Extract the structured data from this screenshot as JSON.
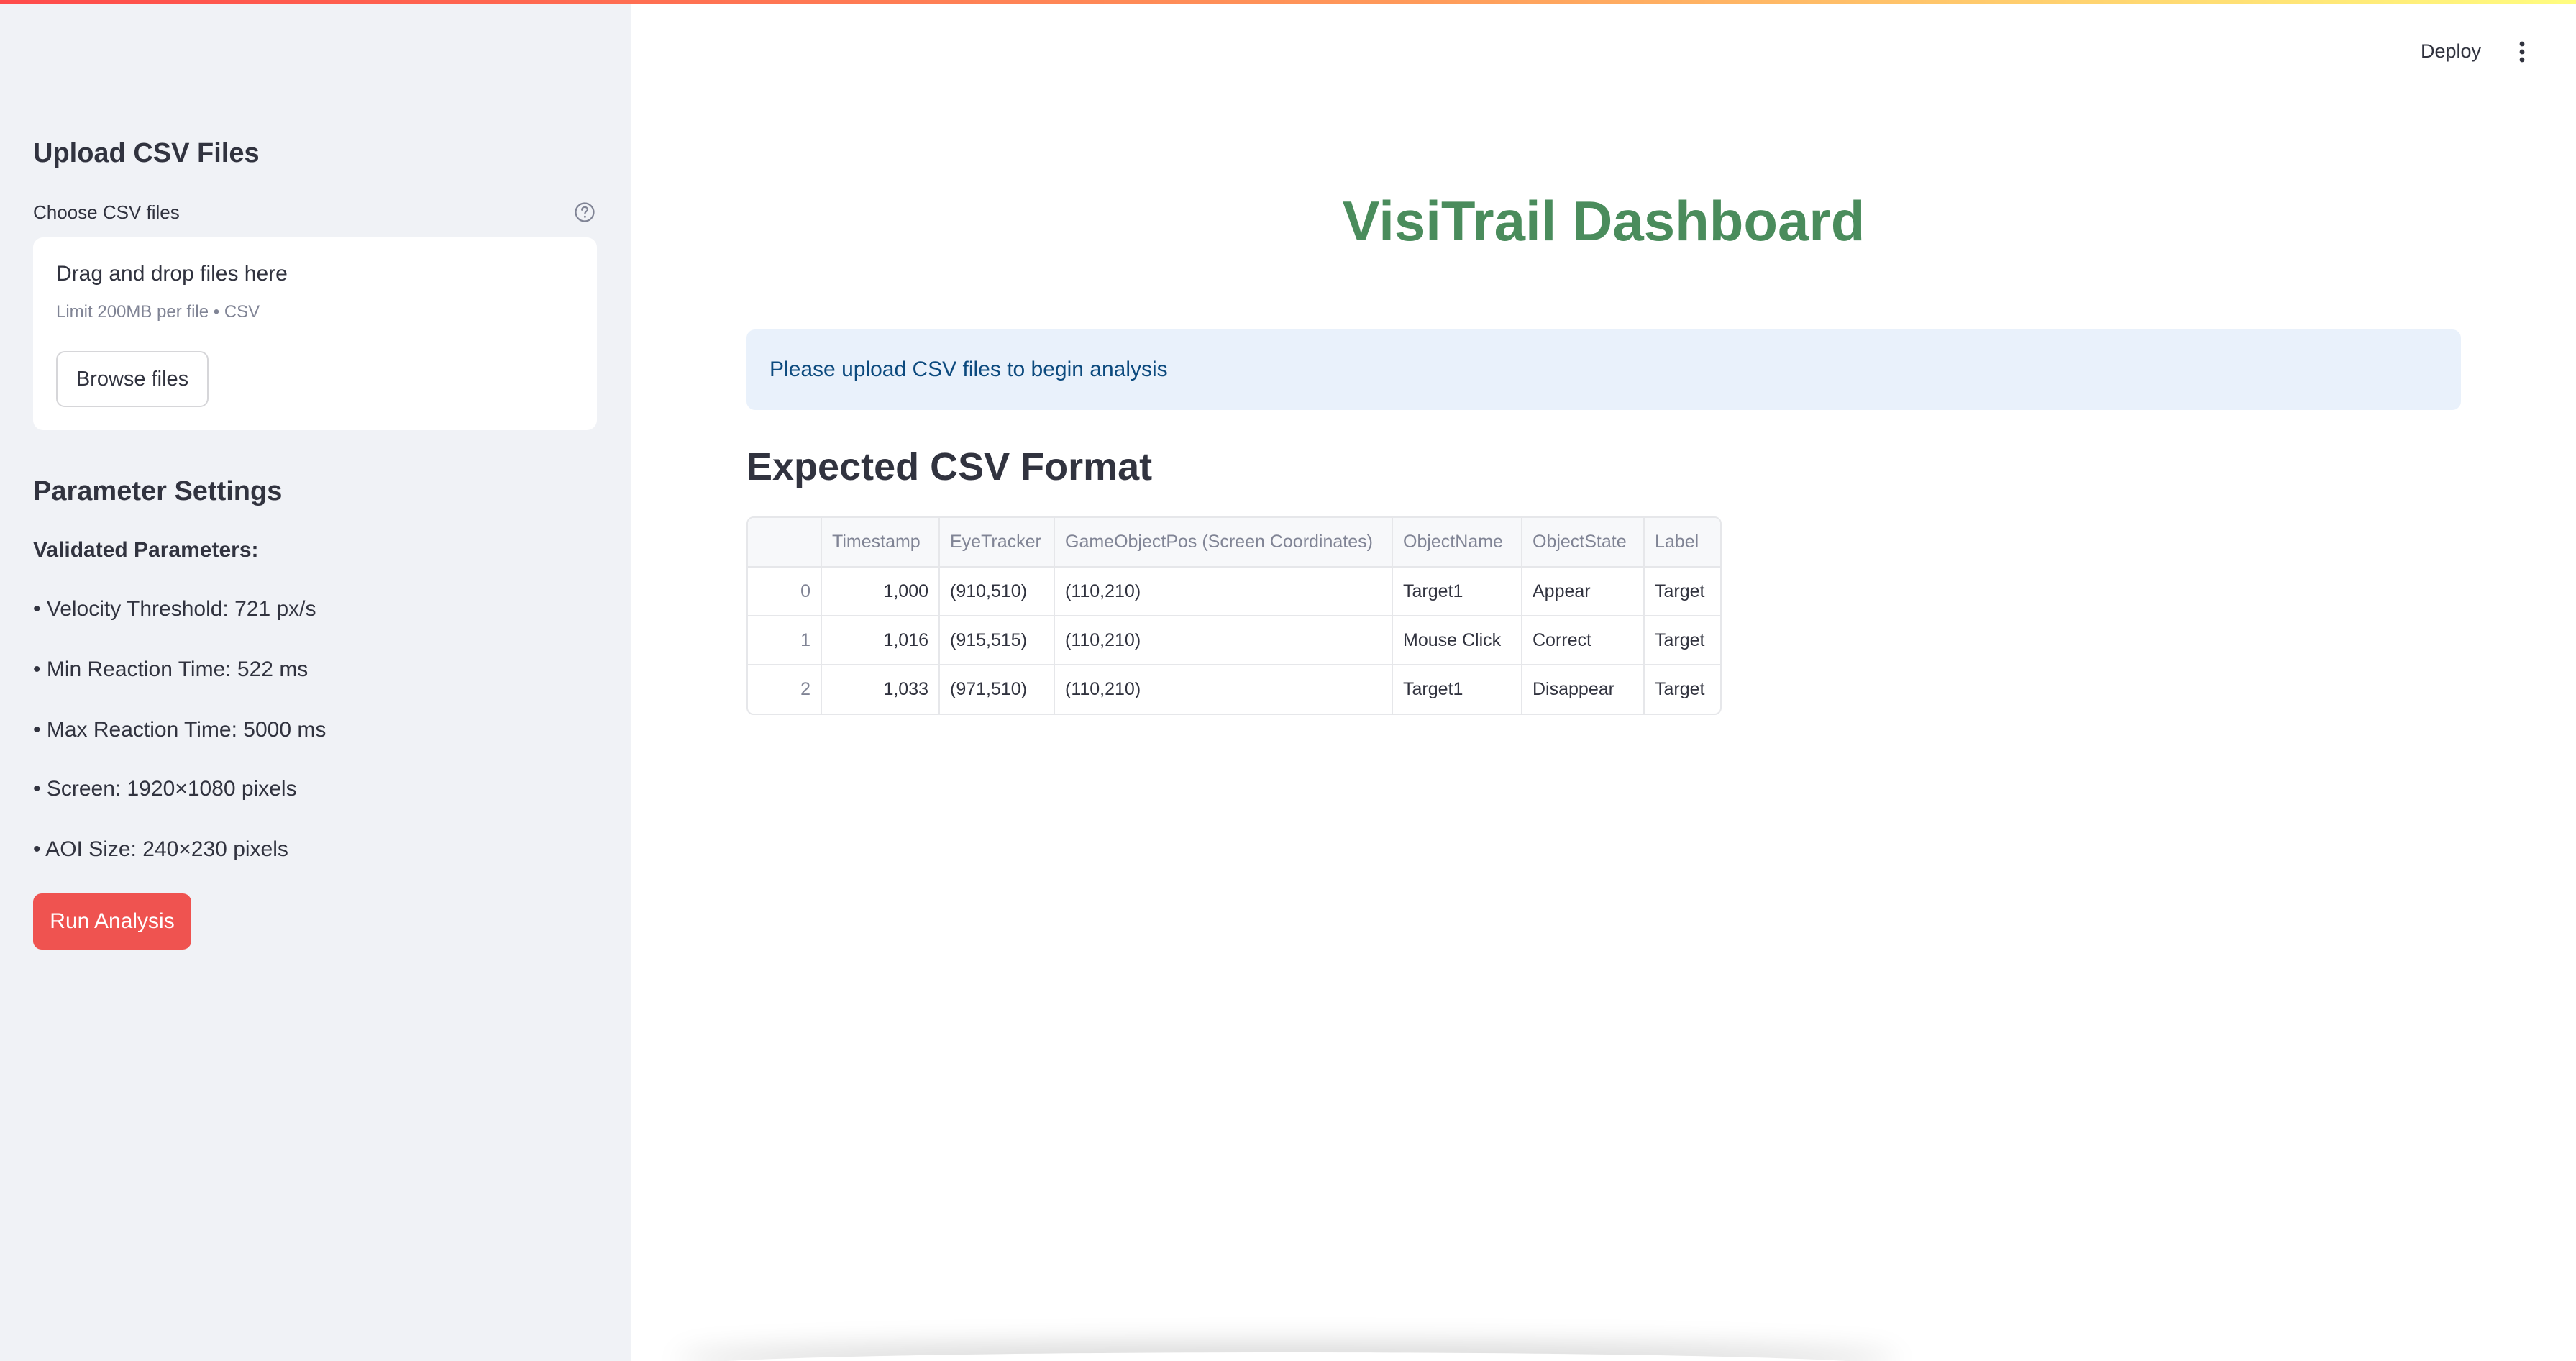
{
  "header": {
    "deploy_label": "Deploy",
    "menu_icon": "vertical-ellipsis-icon"
  },
  "sidebar": {
    "upload_title": "Upload CSV Files",
    "uploader_label": "Choose CSV files",
    "help_icon": "question-circle-icon",
    "dropzone": {
      "title": "Drag and drop files here",
      "limit": "Limit 200MB per file • CSV",
      "browse_label": "Browse files"
    },
    "params_title": "Parameter Settings",
    "validated_title": "Validated Parameters:",
    "params": [
      "• Velocity Threshold: 721 px/s",
      "• Min Reaction Time: 522 ms",
      "• Max Reaction Time: 5000 ms",
      "• Screen: 1920×1080 pixels",
      "• AOI Size: 240×230 pixels"
    ],
    "run_label": "Run Analysis"
  },
  "main": {
    "title": "VisiTrail Dashboard",
    "info": "Please upload CSV files to begin analysis",
    "section_title": "Expected CSV Format",
    "table": {
      "columns": [
        "",
        "Timestamp",
        "EyeTracker",
        "GameObjectPos (Screen Coordinates)",
        "ObjectName",
        "ObjectState",
        "Label"
      ],
      "rows": [
        [
          "0",
          "1,000",
          "(910,510)",
          "(110,210)",
          "Target1",
          "Appear",
          "Target"
        ],
        [
          "1",
          "1,016",
          "(915,515)",
          "(110,210)",
          "Mouse Click",
          "Correct",
          "Target"
        ],
        [
          "2",
          "1,033",
          "(971,510)",
          "(110,210)",
          "Target1",
          "Disappear",
          "Target"
        ]
      ]
    }
  },
  "colors": {
    "accent": "#ef5350",
    "title_green": "#4a8c5c",
    "info_bg": "#e9f1fb",
    "sidebar_bg": "#f0f2f6"
  }
}
